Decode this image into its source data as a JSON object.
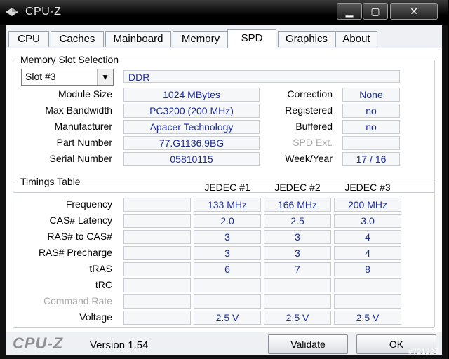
{
  "window": {
    "title": "CPU-Z",
    "icon": "cpu-z-app-icon",
    "min_symbol": "▁",
    "max_symbol": "▢",
    "close_symbol": "✕"
  },
  "tabs": [
    {
      "label": "CPU"
    },
    {
      "label": "Caches"
    },
    {
      "label": "Mainboard"
    },
    {
      "label": "Memory"
    },
    {
      "label": "SPD"
    },
    {
      "label": "Graphics"
    },
    {
      "label": "About"
    }
  ],
  "slot": {
    "legend": "Memory Slot Selection",
    "selected": "Slot #3",
    "type": "DDR",
    "module_size_label": "Module Size",
    "module_size": "1024 MBytes",
    "max_bandwidth_label": "Max Bandwidth",
    "max_bandwidth": "PC3200 (200 MHz)",
    "manufacturer_label": "Manufacturer",
    "manufacturer": "Apacer Technology",
    "part_number_label": "Part Number",
    "part_number": "77.G1136.9BG",
    "serial_number_label": "Serial Number",
    "serial_number": "05810115",
    "correction_label": "Correction",
    "correction": "None",
    "registered_label": "Registered",
    "registered": "no",
    "buffered_label": "Buffered",
    "buffered": "no",
    "spd_ext_label": "SPD Ext.",
    "spd_ext": "",
    "week_year_label": "Week/Year",
    "week_year": "17 / 16"
  },
  "timings": {
    "legend": "Timings Table",
    "columns": [
      "JEDEC #1",
      "JEDEC #2",
      "JEDEC #3"
    ],
    "rows": [
      {
        "label": "Frequency",
        "dim": false,
        "values": [
          "133 MHz",
          "166 MHz",
          "200 MHz"
        ]
      },
      {
        "label": "CAS# Latency",
        "dim": false,
        "values": [
          "2.0",
          "2.5",
          "3.0"
        ]
      },
      {
        "label": "RAS# to CAS#",
        "dim": false,
        "values": [
          "3",
          "3",
          "4"
        ]
      },
      {
        "label": "RAS# Precharge",
        "dim": false,
        "values": [
          "3",
          "3",
          "4"
        ]
      },
      {
        "label": "tRAS",
        "dim": false,
        "values": [
          "6",
          "7",
          "8"
        ]
      },
      {
        "label": "tRC",
        "dim": false,
        "values": [
          "",
          "",
          ""
        ]
      },
      {
        "label": "Command Rate",
        "dim": true,
        "values": [
          "",
          "",
          ""
        ]
      },
      {
        "label": "Voltage",
        "dim": false,
        "values": [
          "2.5 V",
          "2.5 V",
          "2.5 V"
        ]
      }
    ]
  },
  "footer": {
    "logo": "CPU-Z",
    "version": "Version 1.54",
    "validate_label": "Validate",
    "ok_label": "OK"
  },
  "watermark": "#721224"
}
